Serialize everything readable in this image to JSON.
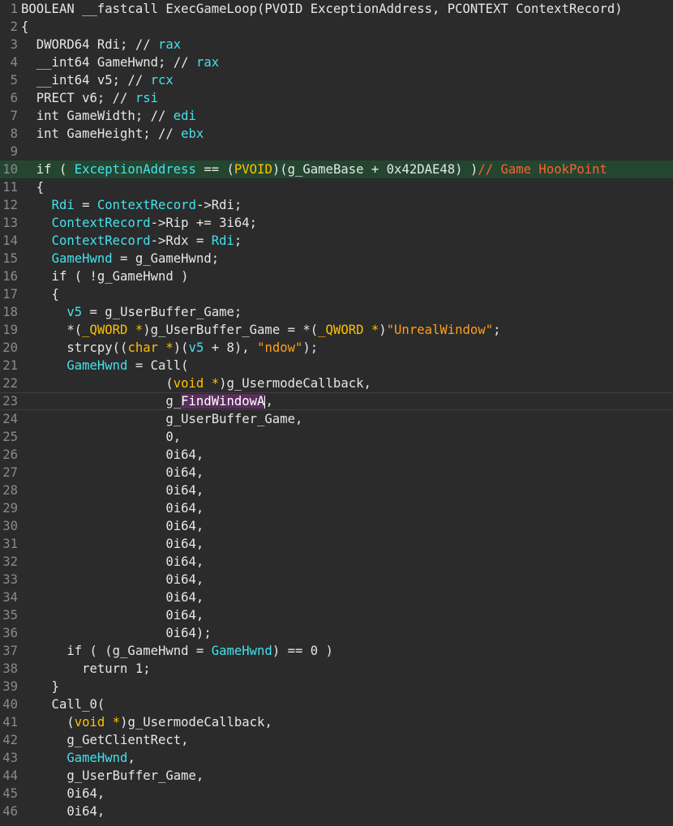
{
  "editor": {
    "lines": [
      {
        "n": "1",
        "tokens": [
          {
            "t": "plain",
            "v": "BOOLEAN __fastcall ExecGameLoop(PVOID ExceptionAddress, PCONTEXT ContextRecord)"
          }
        ]
      },
      {
        "n": "2",
        "tokens": [
          {
            "t": "plain",
            "v": "{"
          }
        ]
      },
      {
        "n": "3",
        "tokens": [
          {
            "t": "plain",
            "v": "  DWORD64 Rdi; // "
          },
          {
            "t": "var",
            "v": "rax"
          }
        ]
      },
      {
        "n": "4",
        "tokens": [
          {
            "t": "plain",
            "v": "  __int64 GameHwnd; // "
          },
          {
            "t": "var",
            "v": "rax"
          }
        ]
      },
      {
        "n": "5",
        "tokens": [
          {
            "t": "plain",
            "v": "  __int64 v5; // "
          },
          {
            "t": "var",
            "v": "rcx"
          }
        ]
      },
      {
        "n": "6",
        "tokens": [
          {
            "t": "plain",
            "v": "  PRECT v6; // "
          },
          {
            "t": "var",
            "v": "rsi"
          }
        ]
      },
      {
        "n": "7",
        "tokens": [
          {
            "t": "plain",
            "v": "  int GameWidth; // "
          },
          {
            "t": "var",
            "v": "edi"
          }
        ]
      },
      {
        "n": "8",
        "tokens": [
          {
            "t": "plain",
            "v": "  int GameHeight; // "
          },
          {
            "t": "var",
            "v": "ebx"
          }
        ]
      },
      {
        "n": "9",
        "tokens": []
      },
      {
        "n": "10",
        "hl": true,
        "tokens": [
          {
            "t": "plain",
            "v": "  if ( "
          },
          {
            "t": "var",
            "v": "ExceptionAddress"
          },
          {
            "t": "plain",
            "v": " == ("
          },
          {
            "t": "type",
            "v": "PVOID"
          },
          {
            "t": "plain",
            "v": ")(g_GameBase + 0x42DAE48) )"
          },
          {
            "t": "cmt",
            "v": "// Game HookPoint"
          }
        ]
      },
      {
        "n": "11",
        "tokens": [
          {
            "t": "plain",
            "v": "  {"
          }
        ]
      },
      {
        "n": "12",
        "tokens": [
          {
            "t": "plain",
            "v": "    "
          },
          {
            "t": "var",
            "v": "Rdi"
          },
          {
            "t": "plain",
            "v": " = "
          },
          {
            "t": "var",
            "v": "ContextRecord"
          },
          {
            "t": "plain",
            "v": "->Rdi;"
          }
        ]
      },
      {
        "n": "13",
        "tokens": [
          {
            "t": "plain",
            "v": "    "
          },
          {
            "t": "var",
            "v": "ContextRecord"
          },
          {
            "t": "plain",
            "v": "->Rip += 3i64;"
          }
        ]
      },
      {
        "n": "14",
        "tokens": [
          {
            "t": "plain",
            "v": "    "
          },
          {
            "t": "var",
            "v": "ContextRecord"
          },
          {
            "t": "plain",
            "v": "->Rdx = "
          },
          {
            "t": "var",
            "v": "Rdi"
          },
          {
            "t": "plain",
            "v": ";"
          }
        ]
      },
      {
        "n": "15",
        "tokens": [
          {
            "t": "plain",
            "v": "    "
          },
          {
            "t": "var",
            "v": "GameHwnd"
          },
          {
            "t": "plain",
            "v": " = g_GameHwnd;"
          }
        ]
      },
      {
        "n": "16",
        "tokens": [
          {
            "t": "plain",
            "v": "    if ( !g_GameHwnd )"
          }
        ]
      },
      {
        "n": "17",
        "tokens": [
          {
            "t": "plain",
            "v": "    {"
          }
        ]
      },
      {
        "n": "18",
        "tokens": [
          {
            "t": "plain",
            "v": "      "
          },
          {
            "t": "var",
            "v": "v5"
          },
          {
            "t": "plain",
            "v": " = g_UserBuffer_Game;"
          }
        ]
      },
      {
        "n": "19",
        "tokens": [
          {
            "t": "plain",
            "v": "      *("
          },
          {
            "t": "type",
            "v": "_QWORD *"
          },
          {
            "t": "plain",
            "v": ")g_UserBuffer_Game = *("
          },
          {
            "t": "type",
            "v": "_QWORD *"
          },
          {
            "t": "plain",
            "v": ")"
          },
          {
            "t": "str",
            "v": "\"UnrealWindow\""
          },
          {
            "t": "plain",
            "v": ";"
          }
        ]
      },
      {
        "n": "20",
        "tokens": [
          {
            "t": "plain",
            "v": "      strcpy(("
          },
          {
            "t": "type",
            "v": "char *"
          },
          {
            "t": "plain",
            "v": ")("
          },
          {
            "t": "var",
            "v": "v5"
          },
          {
            "t": "plain",
            "v": " + 8), "
          },
          {
            "t": "str",
            "v": "\"ndow\""
          },
          {
            "t": "plain",
            "v": ");"
          }
        ]
      },
      {
        "n": "21",
        "tokens": [
          {
            "t": "plain",
            "v": "      "
          },
          {
            "t": "var",
            "v": "GameHwnd"
          },
          {
            "t": "plain",
            "v": " = Call("
          }
        ]
      },
      {
        "n": "22",
        "tokens": [
          {
            "t": "plain",
            "v": "                   ("
          },
          {
            "t": "type",
            "v": "void *"
          },
          {
            "t": "plain",
            "v": ")g_UsermodeCallback,"
          }
        ]
      },
      {
        "n": "23",
        "cursor": true,
        "tokens": [
          {
            "t": "plain",
            "v": "                   g_"
          },
          {
            "t": "sel",
            "v": "FindWindowA"
          },
          {
            "t": "caret",
            "v": ""
          },
          {
            "t": "plain",
            "v": ","
          }
        ]
      },
      {
        "n": "24",
        "tokens": [
          {
            "t": "plain",
            "v": "                   g_UserBuffer_Game,"
          }
        ]
      },
      {
        "n": "25",
        "tokens": [
          {
            "t": "plain",
            "v": "                   0,"
          }
        ]
      },
      {
        "n": "26",
        "tokens": [
          {
            "t": "plain",
            "v": "                   0i64,"
          }
        ]
      },
      {
        "n": "27",
        "tokens": [
          {
            "t": "plain",
            "v": "                   0i64,"
          }
        ]
      },
      {
        "n": "28",
        "tokens": [
          {
            "t": "plain",
            "v": "                   0i64,"
          }
        ]
      },
      {
        "n": "29",
        "tokens": [
          {
            "t": "plain",
            "v": "                   0i64,"
          }
        ]
      },
      {
        "n": "30",
        "tokens": [
          {
            "t": "plain",
            "v": "                   0i64,"
          }
        ]
      },
      {
        "n": "31",
        "tokens": [
          {
            "t": "plain",
            "v": "                   0i64,"
          }
        ]
      },
      {
        "n": "32",
        "tokens": [
          {
            "t": "plain",
            "v": "                   0i64,"
          }
        ]
      },
      {
        "n": "33",
        "tokens": [
          {
            "t": "plain",
            "v": "                   0i64,"
          }
        ]
      },
      {
        "n": "34",
        "tokens": [
          {
            "t": "plain",
            "v": "                   0i64,"
          }
        ]
      },
      {
        "n": "35",
        "tokens": [
          {
            "t": "plain",
            "v": "                   0i64,"
          }
        ]
      },
      {
        "n": "36",
        "tokens": [
          {
            "t": "plain",
            "v": "                   0i64);"
          }
        ]
      },
      {
        "n": "37",
        "tokens": [
          {
            "t": "plain",
            "v": "      if ( (g_GameHwnd = "
          },
          {
            "t": "var",
            "v": "GameHwnd"
          },
          {
            "t": "plain",
            "v": ") == 0 )"
          }
        ]
      },
      {
        "n": "38",
        "tokens": [
          {
            "t": "plain",
            "v": "        return 1;"
          }
        ]
      },
      {
        "n": "39",
        "tokens": [
          {
            "t": "plain",
            "v": "    }"
          }
        ]
      },
      {
        "n": "40",
        "tokens": [
          {
            "t": "plain",
            "v": "    Call_0("
          }
        ]
      },
      {
        "n": "41",
        "tokens": [
          {
            "t": "plain",
            "v": "      ("
          },
          {
            "t": "type",
            "v": "void *"
          },
          {
            "t": "plain",
            "v": ")g_UsermodeCallback,"
          }
        ]
      },
      {
        "n": "42",
        "tokens": [
          {
            "t": "plain",
            "v": "      g_GetClientRect,"
          }
        ]
      },
      {
        "n": "43",
        "tokens": [
          {
            "t": "plain",
            "v": "      "
          },
          {
            "t": "var",
            "v": "GameHwnd"
          },
          {
            "t": "plain",
            "v": ","
          }
        ]
      },
      {
        "n": "44",
        "tokens": [
          {
            "t": "plain",
            "v": "      g_UserBuffer_Game,"
          }
        ]
      },
      {
        "n": "45",
        "tokens": [
          {
            "t": "plain",
            "v": "      0i64,"
          }
        ]
      },
      {
        "n": "46",
        "tokens": [
          {
            "t": "plain",
            "v": "      0i64,"
          }
        ]
      }
    ]
  }
}
